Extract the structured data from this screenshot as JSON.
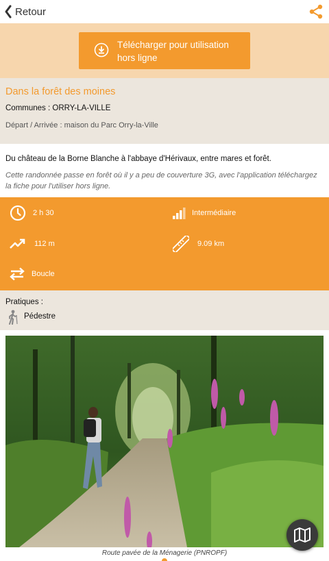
{
  "header": {
    "back_label": "Retour"
  },
  "download": {
    "label": "Télécharger pour utilisation hors ligne"
  },
  "trail": {
    "title": "Dans la forêt des moines",
    "communes": "Communes : ORRY-LA-VILLE",
    "depart": "Départ / Arrivée : maison du Parc Orry-la-Ville",
    "description": "Du château de la Borne Blanche à l'abbaye d'Hérivaux, entre mares et forêt.",
    "warning": "Cette randonnée passe en forêt où il y a peu de couverture 3G, avec l'application téléchargez la fiche pour l'utiliser hors ligne."
  },
  "stats": {
    "duration": "2 h 30",
    "difficulty": "Intermédiaire",
    "elevation": "112 m",
    "distance": "9.09 km",
    "route_type": "Boucle"
  },
  "practices": {
    "label": "Pratiques :",
    "items": [
      "Pédestre"
    ]
  },
  "photo": {
    "caption": "Route pavée de la Ménagerie (PNROPF)"
  },
  "colors": {
    "accent": "#f39a2e",
    "band_light": "#f7d6ad",
    "panel": "#ece6dd"
  },
  "icons": {
    "back": "chevron-left-icon",
    "share": "share-icon",
    "download": "download-icon",
    "duration": "clock-icon",
    "difficulty": "signal-bars-icon",
    "elevation": "trend-up-icon",
    "distance": "ruler-icon",
    "route_type": "loop-arrows-icon",
    "practice": "hiker-icon",
    "map": "map-icon"
  }
}
